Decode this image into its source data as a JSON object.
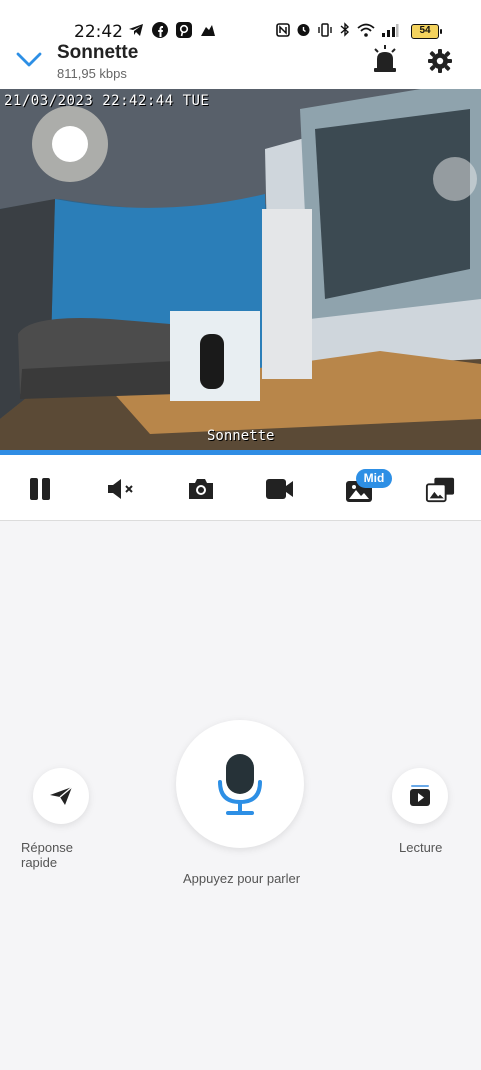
{
  "status_bar": {
    "time": "22:42",
    "battery": "54",
    "icons_left": [
      "telegram-icon",
      "facebook-icon",
      "pinterest-icon",
      "sports-icon"
    ],
    "icons_right": [
      "nfc-icon",
      "alarm-icon",
      "vibrate-icon",
      "bluetooth-icon",
      "wifi-icon",
      "signal-icon"
    ]
  },
  "header": {
    "title": "Sonnette",
    "bitrate": "811,95 kbps"
  },
  "video": {
    "timestamp": "21/03/2023 22:42:44 TUE",
    "camera_name": "Sonnette"
  },
  "toolbar": {
    "items": [
      "pause-icon",
      "mute-icon",
      "snapshot-icon",
      "record-icon",
      "quality-icon",
      "gallery-icon"
    ],
    "quality_badge": "Mid"
  },
  "controls": {
    "quick_reply_label": "Réponse rapide",
    "talk_label": "Appuyez pour parler",
    "playback_label": "Lecture"
  },
  "colors": {
    "accent": "#2d8fe5",
    "background": "#f5f5f7"
  }
}
